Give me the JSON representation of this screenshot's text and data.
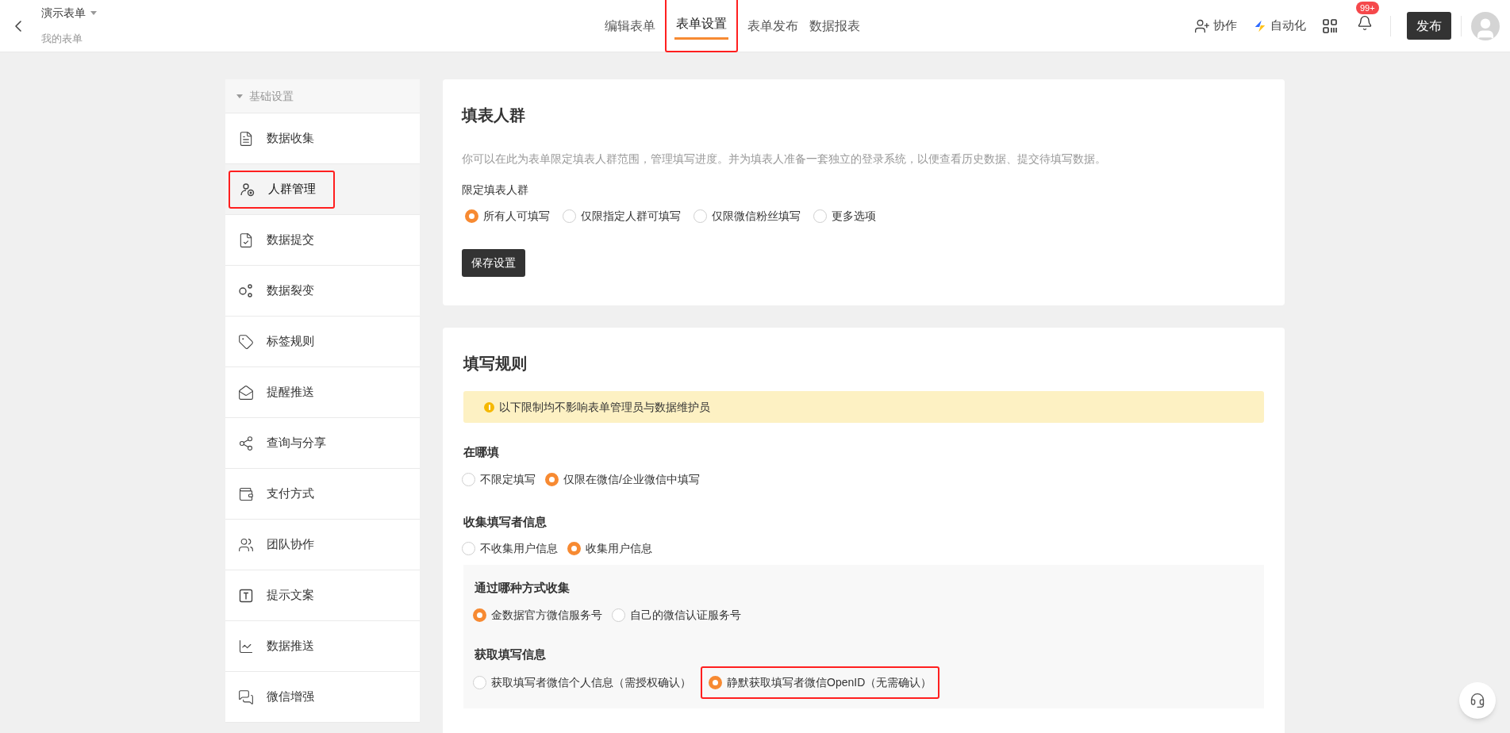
{
  "header": {
    "title": "演示表单",
    "subtitle": "我的表单",
    "tabs": [
      {
        "label": "编辑表单",
        "selected": false,
        "highlighted": false
      },
      {
        "label": "表单设置",
        "selected": true,
        "highlighted": true
      },
      {
        "label": "表单发布",
        "selected": false,
        "highlighted": false
      },
      {
        "label": "数据报表",
        "selected": false,
        "highlighted": false
      }
    ],
    "actions": [
      {
        "kind": "collab",
        "label": "协作"
      },
      {
        "kind": "automation",
        "label": "自动化"
      }
    ],
    "notification_badge": "99+",
    "publish_button": "发布"
  },
  "sidebar": {
    "group": "基础设置",
    "expanded": true,
    "items": [
      {
        "label": "数据收集",
        "selected": false,
        "highlighted": false
      },
      {
        "label": "人群管理",
        "selected": true,
        "highlighted": true
      },
      {
        "label": "数据提交",
        "selected": false,
        "highlighted": false
      },
      {
        "label": "数据裂变",
        "selected": false,
        "highlighted": false
      },
      {
        "label": "标签规则",
        "selected": false,
        "highlighted": false
      },
      {
        "label": "提醒推送",
        "selected": false,
        "highlighted": false
      },
      {
        "label": "查询与分享",
        "selected": false,
        "highlighted": false
      },
      {
        "label": "支付方式",
        "selected": false,
        "highlighted": false
      },
      {
        "label": "团队协作",
        "selected": false,
        "highlighted": false
      },
      {
        "label": "提示文案",
        "selected": false,
        "highlighted": false
      },
      {
        "label": "数据推送",
        "selected": false,
        "highlighted": false
      },
      {
        "label": "微信增强",
        "selected": false,
        "highlighted": false
      }
    ]
  },
  "audience_card": {
    "title": "填表人群",
    "description": "你可以在此为表单限定填表人群范围，管理填写进度。并为填表人准备一套独立的登录系统，以便查看历史数据、提交待填写数据。",
    "field_label": "限定填表人群",
    "options": [
      {
        "label": "所有人可填写",
        "selected": true,
        "highlighted": false
      },
      {
        "label": "仅限指定人群可填写",
        "selected": false,
        "highlighted": false
      },
      {
        "label": "仅限微信粉丝填写",
        "selected": false,
        "highlighted": false
      },
      {
        "label": "更多选项",
        "selected": false,
        "highlighted": false
      }
    ],
    "save_button": "保存设置"
  },
  "rules_card": {
    "title": "填写规则",
    "notice": "以下限制均不影响表单管理员与数据维护员",
    "sections": [
      {
        "label": "在哪填",
        "options": [
          {
            "label": "不限定填写",
            "selected": false,
            "highlighted": false
          },
          {
            "label": "仅限在微信/企业微信中填写",
            "selected": true,
            "highlighted": false
          }
        ]
      },
      {
        "label": "收集填写者信息",
        "options": [
          {
            "label": "不收集用户信息",
            "selected": false,
            "highlighted": false
          },
          {
            "label": "收集用户信息",
            "selected": true,
            "highlighted": false
          }
        ]
      }
    ],
    "sub_sections": [
      {
        "label": "通过哪种方式收集",
        "options": [
          {
            "label": "金数据官方微信服务号",
            "selected": true,
            "highlighted": false
          },
          {
            "label": "自己的微信认证服务号",
            "selected": false,
            "highlighted": false
          }
        ]
      },
      {
        "label": "获取填写信息",
        "options": [
          {
            "label": "获取填写者微信个人信息（需授权确认）",
            "selected": false,
            "highlighted": false
          },
          {
            "label": "静默获取填写者微信OpenID（无需确认）",
            "selected": true,
            "highlighted": true
          }
        ]
      }
    ]
  }
}
